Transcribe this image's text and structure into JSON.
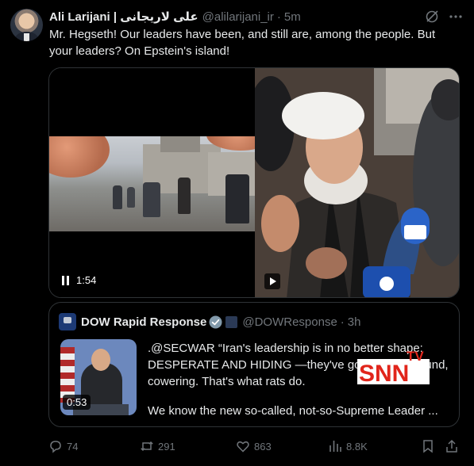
{
  "tweet": {
    "author_name": "Ali Larijani | علی لاریجانی",
    "handle": "@alilarijani_ir",
    "separator": "·",
    "time": "5m",
    "text": "Mr. Hegseth! Our leaders have been, and still are, among the people. But your leaders? On Epstein's island!",
    "icons": {
      "grok": "grok-icon",
      "more": "more-horizontal-icon"
    }
  },
  "media": {
    "left_video": {
      "duration": "1:54",
      "control_icon": "pause-icon"
    },
    "right_video": {
      "control_icon": "play-icon"
    }
  },
  "quote": {
    "author_name": "DOW Rapid Response",
    "handle": "@DOWResponse",
    "separator": "·",
    "time": "3h",
    "video_duration": "0:53",
    "text": ".@SECWAR “Iran's leadership is in no better shape: DESPERATE AND HIDING —they've gone underground, cowering. That's what rats do.",
    "text_more": "We know the new so-called, not-so-Supreme Leader ...",
    "badge_colors": {
      "verified": "#829aab",
      "gov": "#2b3a56"
    }
  },
  "watermark": {
    "tv": "TV",
    "brand": "SNN"
  },
  "actions": {
    "reply": "74",
    "repost": "291",
    "like": "863",
    "views": "8.8K"
  },
  "colors": {
    "background": "#000000",
    "text": "#e7e9ea",
    "muted": "#71767b",
    "border": "#2f3336",
    "watermark_red": "#e1251b"
  }
}
